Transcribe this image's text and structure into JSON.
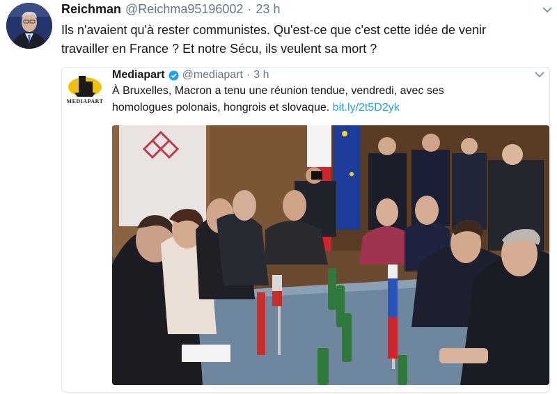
{
  "tweet": {
    "display_name": "Reichman",
    "handle": "@Reichma95196002",
    "separator": "·",
    "time": "23 h",
    "text_line1": "Ils n'avaient qu'à rester communistes. Qu'est-ce que c'est cette idée de venir",
    "text_line2": "travailler en France ? Et notre Sécu, ils veulent sa mort ?"
  },
  "quoted": {
    "display_name": "Mediapart",
    "handle": "@mediapart",
    "separator": "·",
    "time": "3 h",
    "text_line1": "À Bruxelles, Macron a tenu une réunion tendue, vendredi, avec ses",
    "text_line2_prefix": "homologues polonais, hongrois et slovaque.",
    "link": "bit.ly/2t5D2yk",
    "logo_text": "MEDIAPART"
  },
  "colors": {
    "link": "#1da1f2",
    "verified": "#1da1f2",
    "muted": "#657786"
  },
  "icons": [
    "chevron-down-icon",
    "verified-badge-icon"
  ]
}
